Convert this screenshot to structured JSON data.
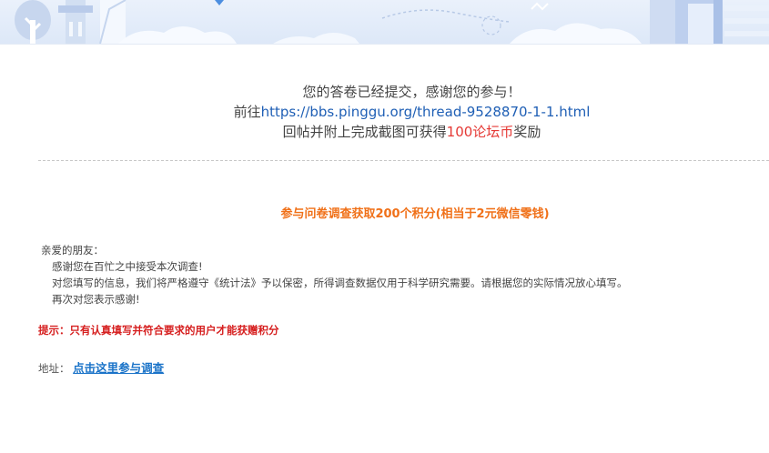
{
  "thanks": {
    "line1": "您的答卷已经提交，感谢您的参与！",
    "line2_prefix": "前往",
    "line2_link": "https://bbs.pinggu.org/thread-9528870-1-1.html",
    "line3_prefix": "回帖并附上完成截图可获得",
    "line3_highlight": "100论坛币",
    "line3_suffix": "奖励"
  },
  "headline": "参与问卷调查获取200个积分(相当于2元微信零钱)",
  "letter": {
    "greeting": "亲爱的朋友：",
    "p1": "感谢您在百忙之中接受本次调查!",
    "p2": "对您填写的信息，我们将严格遵守《统计法》予以保密，所得调查数据仅用于科学研究需要。请根据您的实际情况放心填写。",
    "p3": "再次对您表示感谢!"
  },
  "tip": "提示：只有认真填写并符合要求的用户才能获赠积分",
  "address": {
    "label": "地址：",
    "link": "点击这里参与调查"
  },
  "colors": {
    "link_blue": "#1f5fb5",
    "highlight_red": "#e53935",
    "headline_orange": "#f07018",
    "tip_red": "#d61f1f"
  }
}
